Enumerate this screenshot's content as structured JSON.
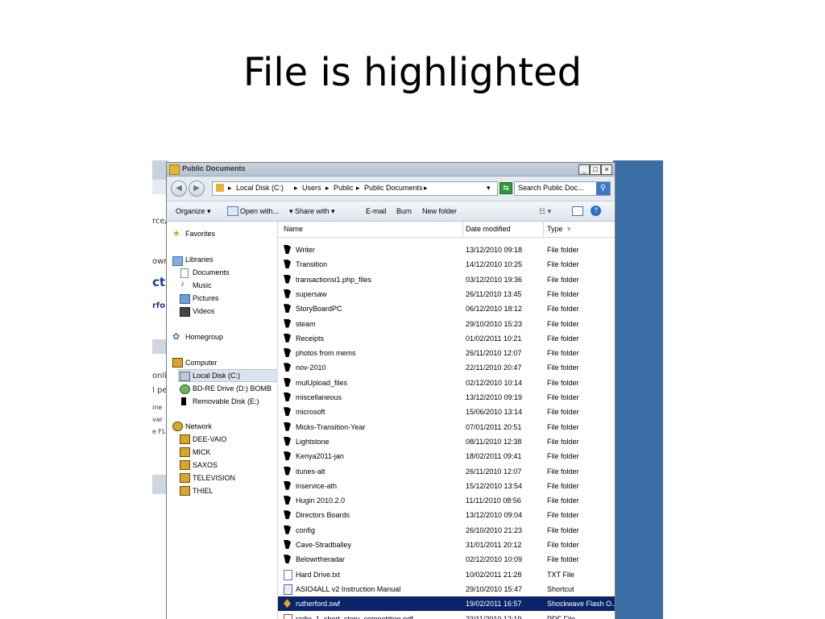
{
  "slide": {
    "title": "File is highlighted"
  },
  "background_app": {
    "fragments": [
      "rce/",
      "ownl",
      "ctı",
      "rfo",
      "onli",
      "l pe",
      "ine",
      "var",
      "e FL"
    ]
  },
  "window": {
    "title": "Public Documents",
    "min_label": "_",
    "max_label": "□",
    "close_label": "×",
    "address": {
      "crumbs": [
        "Local Disk (C:)",
        "Users",
        "Public",
        "Public Documents"
      ],
      "separator": "▸"
    },
    "search_placeholder": "Search Public Doc...",
    "toolbar": {
      "organize": "Organize ▾",
      "open_with": "Open with...",
      "share_with": "▾   Share with ▾",
      "email": "E-mail",
      "burn": "Burn",
      "new_folder": "New folder"
    },
    "nav": {
      "favorites": "Favorites",
      "libraries": "Libraries",
      "documents": "Documents",
      "music": "Music",
      "pictures": "Pictures",
      "videos": "Videos",
      "homegroup": "Homegroup",
      "computer": "Computer",
      "local_disk": "Local Disk (C:)",
      "bd_drive": "BD-RE Drive (D:) BOMB",
      "removable": "Removable Disk (E:)",
      "network": "Network",
      "net_items": [
        "DEE-VAIO",
        "MICK",
        "SAXOS",
        "TELEVISION",
        "THIEL"
      ]
    },
    "columns": {
      "name": "Name",
      "date": "Date modified",
      "type": "Type"
    },
    "files": [
      {
        "name": "Writer",
        "date": "13/12/2010 09:18",
        "type": "File folder",
        "icon": "folder-icon"
      },
      {
        "name": "Transition",
        "date": "14/12/2010 10:25",
        "type": "File folder",
        "icon": "folder-icon"
      },
      {
        "name": "transactionsi1.php_files",
        "date": "03/12/2010 19:36",
        "type": "File folder",
        "icon": "folder-icon"
      },
      {
        "name": "supersaw",
        "date": "26/11/2010 13:45",
        "type": "File folder",
        "icon": "folder-icon"
      },
      {
        "name": "StoryBoardPC",
        "date": "06/12/2010 18:12",
        "type": "File folder",
        "icon": "folder-icon"
      },
      {
        "name": "steam",
        "date": "29/10/2010 15:23",
        "type": "File folder",
        "icon": "folder-icon"
      },
      {
        "name": "Receipts",
        "date": "01/02/2011 10:21",
        "type": "File folder",
        "icon": "folder-icon"
      },
      {
        "name": "photos from mems",
        "date": "26/11/2010 12:07",
        "type": "File folder",
        "icon": "folder-icon"
      },
      {
        "name": "nov-2010",
        "date": "22/11/2010 20:47",
        "type": "File folder",
        "icon": "folder-icon"
      },
      {
        "name": "mulUpload_files",
        "date": "02/12/2010 10:14",
        "type": "File folder",
        "icon": "folder-icon"
      },
      {
        "name": "miscellaneous",
        "date": "13/12/2010 09:19",
        "type": "File folder",
        "icon": "folder-icon"
      },
      {
        "name": "microsoft",
        "date": "15/06/2010 13:14",
        "type": "File folder",
        "icon": "folder-icon"
      },
      {
        "name": "Micks-Transition-Year",
        "date": "07/01/2011 20:51",
        "type": "File folder",
        "icon": "folder-icon"
      },
      {
        "name": "Lightstone",
        "date": "08/11/2010 12:38",
        "type": "File folder",
        "icon": "folder-icon"
      },
      {
        "name": "Kenya2011-jan",
        "date": "18/02/2011 09:41",
        "type": "File folder",
        "icon": "folder-icon"
      },
      {
        "name": "itunes-alt",
        "date": "26/11/2010 12:07",
        "type": "File folder",
        "icon": "folder-icon"
      },
      {
        "name": "inservice-ath",
        "date": "15/12/2010 13:54",
        "type": "File folder",
        "icon": "folder-icon"
      },
      {
        "name": "Hugin 2010.2.0",
        "date": "11/11/2010 08:56",
        "type": "File folder",
        "icon": "folder-icon"
      },
      {
        "name": "Directors Boards",
        "date": "13/12/2010 09:04",
        "type": "File folder",
        "icon": "folder-icon"
      },
      {
        "name": "config",
        "date": "26/10/2010 21:23",
        "type": "File folder",
        "icon": "folder-icon"
      },
      {
        "name": "Cave-Stradballey",
        "date": "31/01/2011 20:12",
        "type": "File folder",
        "icon": "folder-icon"
      },
      {
        "name": "Belowrtheradar",
        "date": "02/12/2010 10:09",
        "type": "File folder",
        "icon": "folder-icon"
      },
      {
        "name": "Hard Drive.txt",
        "date": "10/02/2011 21:28",
        "type": "TXT File",
        "icon": "text-file-icon"
      },
      {
        "name": "ASIO4ALL v2 Instruction Manual",
        "date": "29/10/2010 15:47",
        "type": "Shortcut",
        "icon": "shortcut-icon"
      },
      {
        "name": "rutherford.swf",
        "date": "19/02/2011 16:57",
        "type": "Shockwave Flash O...",
        "icon": "flash-file-icon",
        "selected": true
      },
      {
        "name": "radio_1_short_story_competition.pdf",
        "date": "23/11/2010 12:19",
        "type": "PDF File",
        "icon": "pdf-file-icon"
      }
    ]
  }
}
